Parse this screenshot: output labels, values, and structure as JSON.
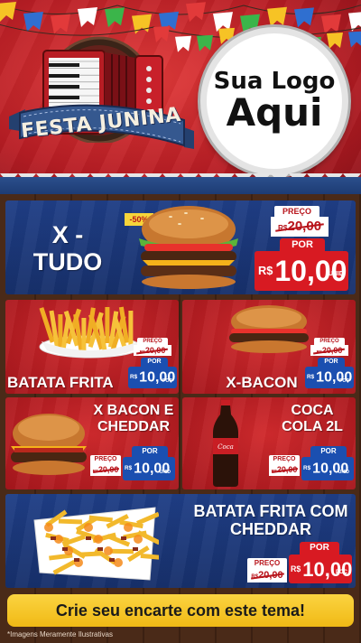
{
  "header": {
    "festa_label": "FESTA JUNINA",
    "logo_line1": "Sua Logo",
    "logo_line2": "Aqui"
  },
  "products": [
    {
      "name": "X - TUDO",
      "discount": "-50%",
      "preco_label": "PREÇO",
      "old_price": "20,00",
      "por_label": "POR",
      "new_price": "10,00",
      "unit": "UNID",
      "currency": "R$"
    },
    {
      "name": "BATATA FRITA",
      "preco_label": "PREÇO",
      "old_price": "20,00",
      "por_label": "POR",
      "new_price": "10,00",
      "unit": "POÇ",
      "currency": "R$"
    },
    {
      "name": "X-BACON",
      "preco_label": "PREÇO",
      "old_price": "20,00",
      "por_label": "POR",
      "new_price": "10,00",
      "unit": "POÇ",
      "currency": "R$"
    },
    {
      "name": "X BACON E CHEDDAR",
      "preco_label": "PREÇO",
      "old_price": "20,00",
      "por_label": "POR",
      "new_price": "10,00",
      "unit": "UNID",
      "currency": "R$"
    },
    {
      "name": "COCA COLA 2L",
      "preco_label": "PREÇO",
      "old_price": "20,00",
      "por_label": "POR",
      "new_price": "10,00",
      "unit": "UNID",
      "currency": "R$"
    },
    {
      "name": "BATATA FRITA COM CHEDDAR",
      "preco_label": "PREÇO",
      "old_price": "20,00",
      "por_label": "POR",
      "new_price": "10,00",
      "unit": "POÇ",
      "currency": "R$"
    }
  ],
  "cta": "Crie seu encarte com este tema!",
  "footnote": "*Imagens Meramente Ilustrativas",
  "colors": {
    "red": "#b8141b",
    "blue": "#1b4fb0",
    "yellow": "#f7c52a"
  },
  "icons": [
    "accordion-image",
    "burger-image",
    "fries-image",
    "cola-bottle-image",
    "cheese-fries-image"
  ]
}
